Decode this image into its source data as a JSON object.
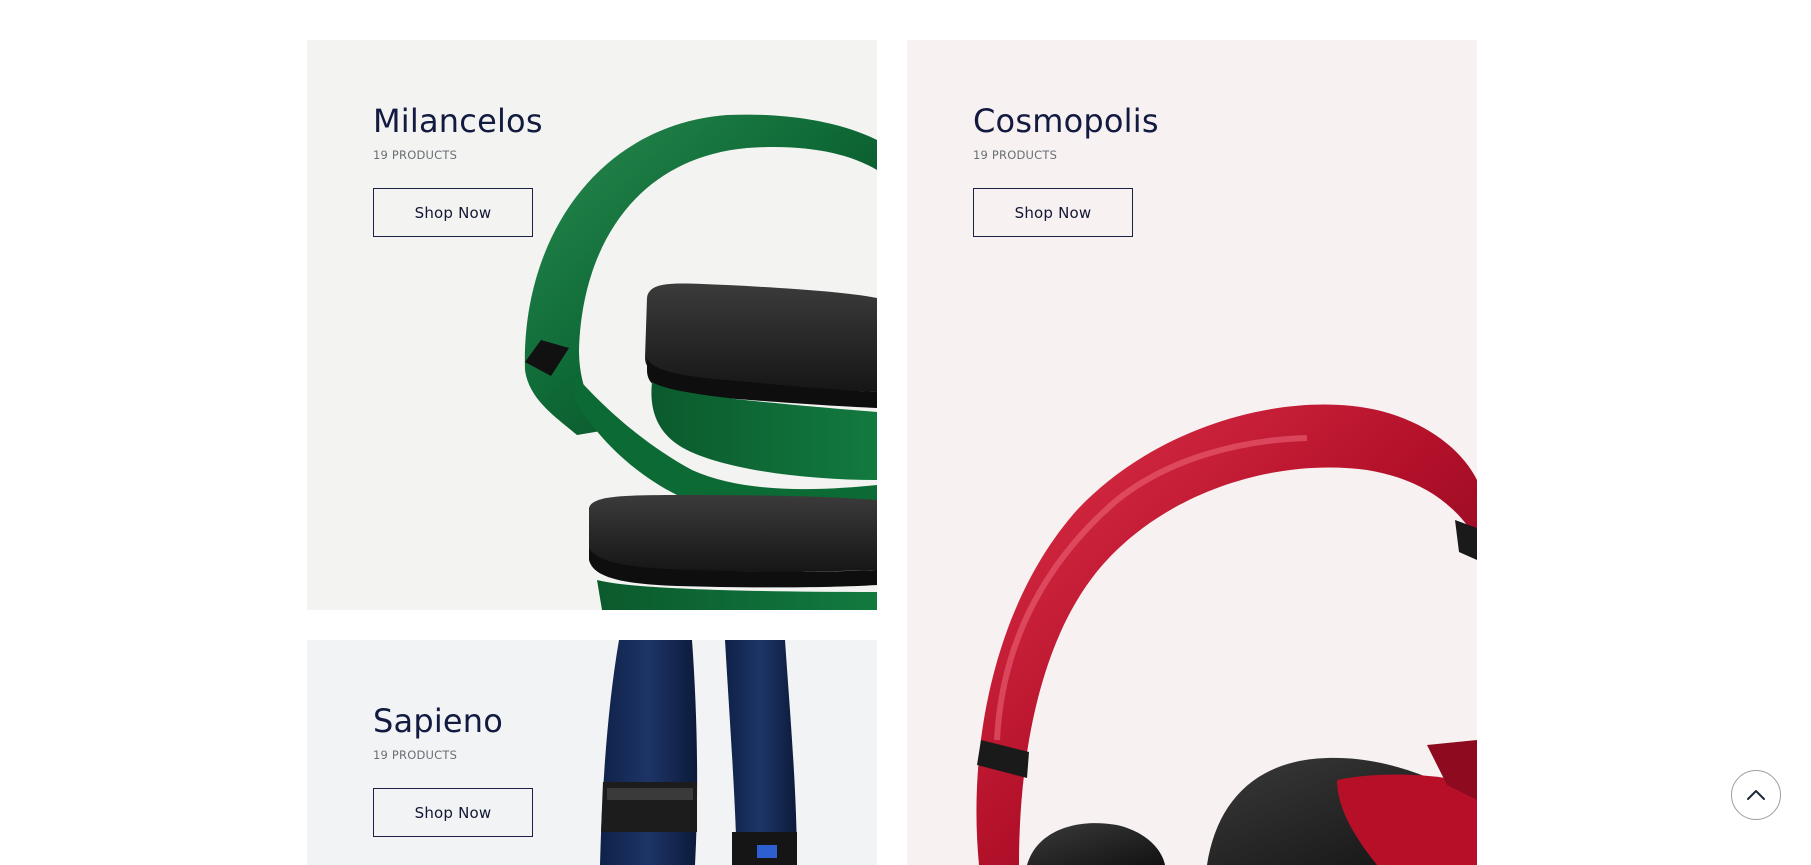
{
  "collections": [
    {
      "name": "Milancelos",
      "count_label": "19 PRODUCTS",
      "button_label": "Shop Now",
      "background": "#f3f4f2",
      "product_color": "#0f6b37"
    },
    {
      "name": "Cosmopolis",
      "count_label": "19 PRODUCTS",
      "button_label": "Shop Now",
      "background": "#f7f1f1",
      "product_color": "#c0142e"
    },
    {
      "name": "Sapieno",
      "count_label": "19 PRODUCTS",
      "button_label": "Shop Now",
      "background": "#f2f3f5",
      "product_color": "#162c57"
    }
  ],
  "back_to_top": {
    "icon": "chevron-up-icon"
  }
}
